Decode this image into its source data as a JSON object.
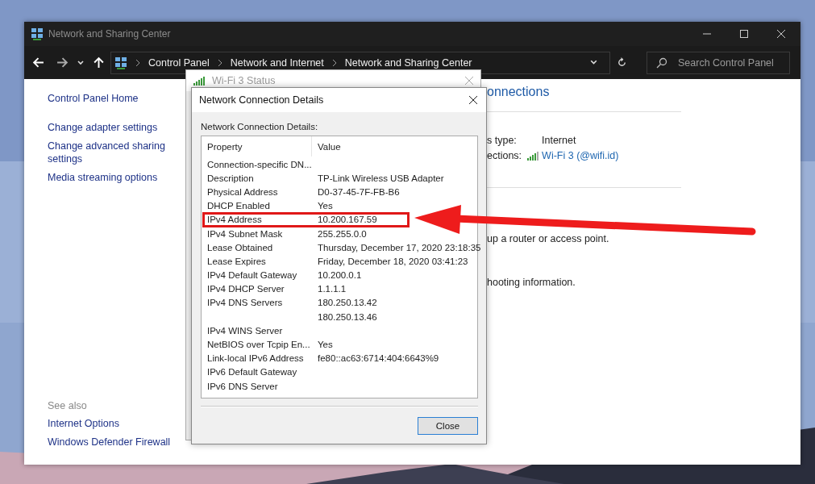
{
  "main_window": {
    "title": "Network and Sharing Center",
    "breadcrumb": [
      "Control Panel",
      "Network and Internet",
      "Network and Sharing Center"
    ],
    "search": {
      "placeholder": "Search Control Panel"
    },
    "sidebar": {
      "items": [
        "Control Panel Home",
        "Change adapter settings",
        "Change advanced sharing settings",
        "Media streaming options"
      ],
      "see_also_title": "See also",
      "see_also": [
        "Internet Options",
        "Windows Defender Firewall"
      ]
    },
    "content": {
      "heading": "onnections",
      "access_type_label": "s type:",
      "access_type_value": "Internet",
      "connections_label": "ections:",
      "connection_link": "Wi-Fi 3 (@wifi.id)",
      "text_1": "up a router or access point.",
      "text_2": "hooting information."
    }
  },
  "status_dialog": {
    "title": "Wi-Fi 3 Status"
  },
  "details_dialog": {
    "title": "Network Connection Details",
    "label": "Network Connection Details:",
    "columns": [
      "Property",
      "Value"
    ],
    "rows": [
      {
        "property": "Connection-specific DN...",
        "highlighted": false
      },
      {
        "property": "Description",
        "value": "TP-Link Wireless USB Adapter",
        "highlighted": false
      },
      {
        "property": "Physical Address",
        "value": "D0-37-45-7F-FB-B6",
        "highlighted": false
      },
      {
        "property": "DHCP Enabled",
        "value": "Yes",
        "highlighted": false
      },
      {
        "property": "IPv4 Address",
        "value": "10.200.167.59",
        "highlighted": true
      },
      {
        "property": "IPv4 Subnet Mask",
        "value": "255.255.0.0",
        "highlighted": false
      },
      {
        "property": "Lease Obtained",
        "value": "Thursday, December 17, 2020 23:18:35",
        "highlighted": false
      },
      {
        "property": "Lease Expires",
        "value": "Friday, December 18, 2020 03:41:23",
        "highlighted": false
      },
      {
        "property": "IPv4 Default Gateway",
        "value": "10.200.0.1",
        "highlighted": false
      },
      {
        "property": "IPv4 DHCP Server",
        "value": "1.1.1.1",
        "highlighted": false
      },
      {
        "property": "IPv4 DNS Servers",
        "value": "180.250.13.42",
        "highlighted": false
      },
      {
        "value": "180.250.13.46",
        "highlighted": false
      },
      {
        "property": "IPv4 WINS Server",
        "highlighted": false
      },
      {
        "property": "NetBIOS over Tcpip En...",
        "value": "Yes",
        "highlighted": false
      },
      {
        "property": "Link-local IPv6 Address",
        "value": "fe80::ac63:6714:404:6643%9",
        "highlighted": false
      },
      {
        "property": "IPv6 Default Gateway",
        "highlighted": false
      },
      {
        "property": "IPv6 DNS Server",
        "highlighted": false
      }
    ],
    "buttons": [
      "Close"
    ]
  }
}
